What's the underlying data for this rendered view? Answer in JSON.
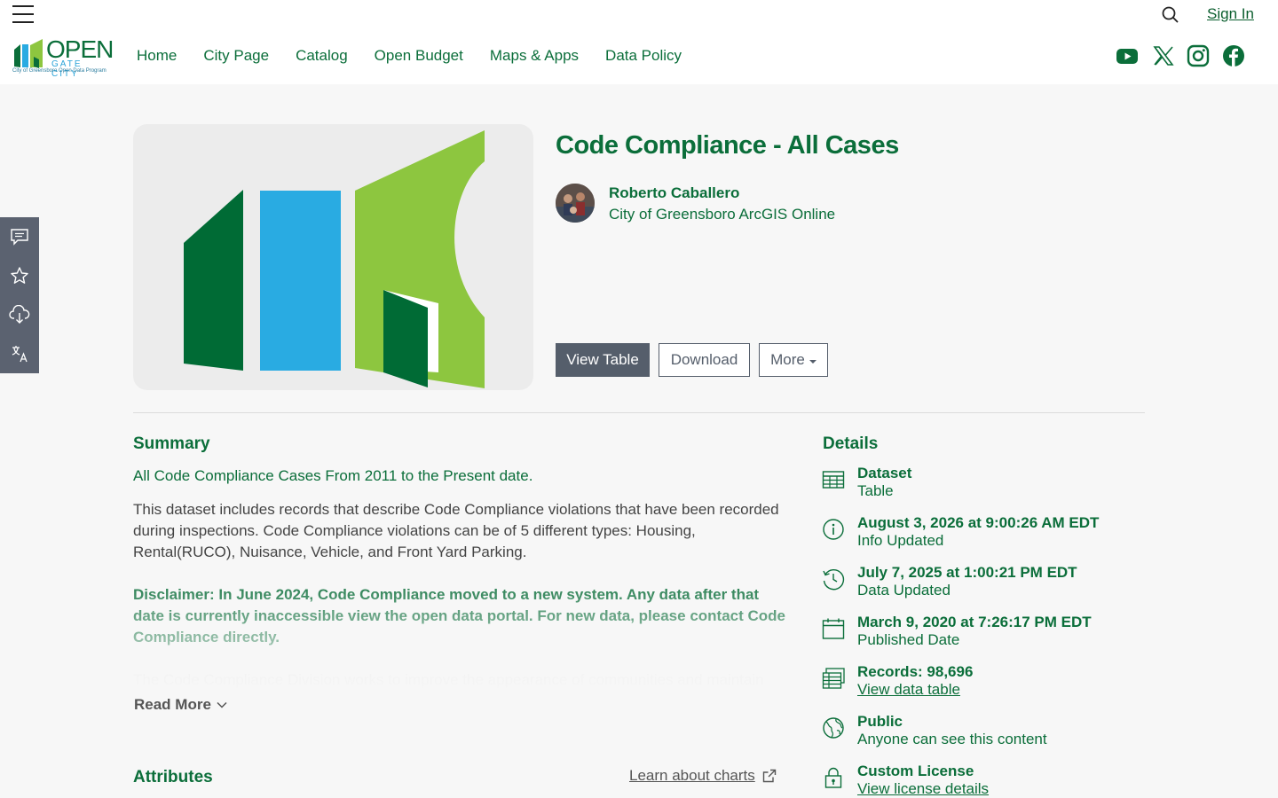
{
  "header": {
    "signin_label": "Sign In",
    "logo": {
      "text": "OPEN",
      "sub": "GATE CITY",
      "tagline": "City of Greensboro Open Data Program"
    },
    "nav": [
      "Home",
      "City Page",
      "Catalog",
      "Open Budget",
      "Maps & Apps",
      "Data Policy"
    ],
    "social": [
      "youtube-icon",
      "x-twitter-icon",
      "instagram-icon",
      "facebook-icon"
    ]
  },
  "colors": {
    "brand_green": "#0b6e3a",
    "button_gray": "#555e6b",
    "light_green": "#8dc63f",
    "blue": "#29abe2"
  },
  "sidebar": [
    "comment-icon",
    "star-icon",
    "cloud-download-icon",
    "translate-icon"
  ],
  "item": {
    "title": "Code Compliance - All Cases",
    "owner_name": "Roberto Caballero",
    "owner_org": "City of Greensboro ArcGIS Online",
    "buttons": {
      "view_table": "View Table",
      "download": "Download",
      "more": "More"
    }
  },
  "summary": {
    "heading": "Summary",
    "lead": "All Code Compliance Cases From 2011 to the Present date.",
    "body": "This dataset includes records that describe Code Compliance violations that have been recorded during inspections. Code Compliance violations can be of 5 different types: Housing, Rental(RUCO), Nuisance, Vehicle, and Front Yard Parking.",
    "disclaimer": "Disclaimer: In June 2024, Code Compliance moved to a new system.  Any data after that date is currently inaccessible view the open data portal.  For new data, please contact Code Compliance directly.",
    "faded": "The Code Compliance Division works to improve the appearance of communities and maintain",
    "read_more": "Read More"
  },
  "attributes": {
    "heading": "Attributes",
    "learn_link": "Learn about charts"
  },
  "details": {
    "heading": "Details",
    "items": [
      {
        "icon": "table-icon",
        "main": "Dataset",
        "sub": "Table",
        "sub_is_link": false
      },
      {
        "icon": "info-icon",
        "main": "August 3, 2026 at 9:00:26 AM EDT",
        "sub": "Info Updated",
        "sub_is_link": false
      },
      {
        "icon": "history-icon",
        "main": "July 7, 2025 at 1:00:21 PM EDT",
        "sub": "Data Updated",
        "sub_is_link": false
      },
      {
        "icon": "calendar-icon",
        "main": "March 9, 2020 at 7:26:17 PM EDT",
        "sub": "Published Date",
        "sub_is_link": false
      },
      {
        "icon": "records-icon",
        "main": "Records: 98,696",
        "sub": "View data table",
        "sub_is_link": true
      },
      {
        "icon": "globe-icon",
        "main": "Public",
        "sub": "Anyone can see this content",
        "sub_is_link": false
      },
      {
        "icon": "lock-icon",
        "main": "Custom License",
        "sub": "View license details",
        "sub_is_link": true
      }
    ]
  }
}
